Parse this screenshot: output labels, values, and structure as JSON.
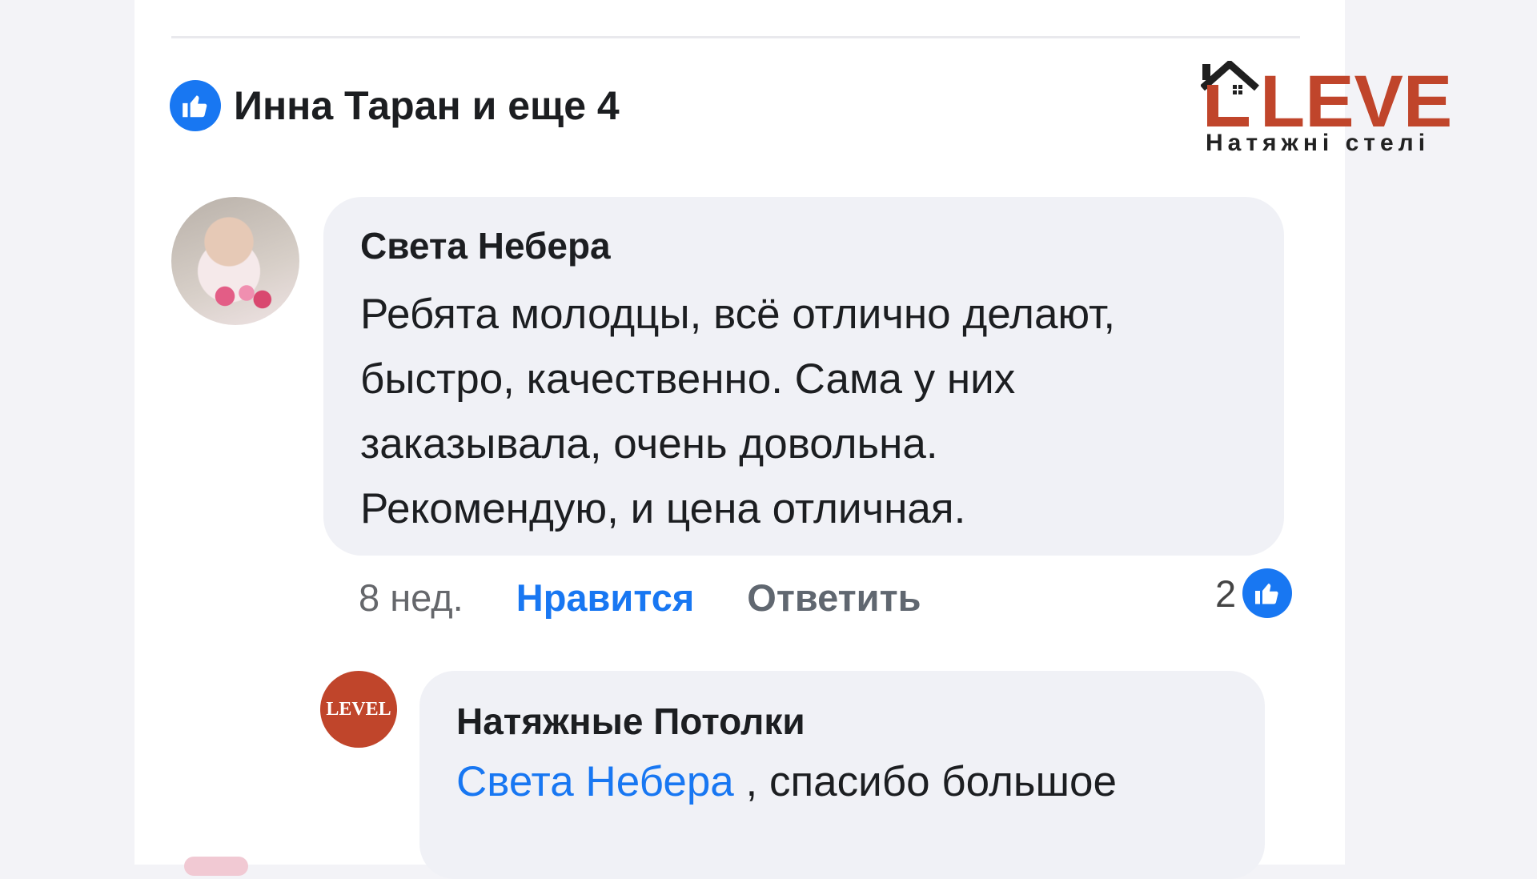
{
  "reactions_summary": {
    "text": "Инна Таран и еще 4",
    "icon": "like-icon"
  },
  "brand": {
    "name": "LEVEL",
    "subtitle": "Натяжні стелі",
    "color": "#c0452b"
  },
  "comment": {
    "author": "Света Небера",
    "lines": [
      "Ребята молодцы, всё отлично делают,",
      "быстро, качественно. Сама у них",
      "заказывала, очень довольна.",
      "Рекомендую, и цена отличная."
    ],
    "time": "8 нед.",
    "like_label": "Нравится",
    "reply_label": "Ответить",
    "reaction_count": "2"
  },
  "reply": {
    "author": "Натяжные Потолки",
    "avatar_text": "LEVEL",
    "mention": "Света Небера",
    "text": " , спасибо большое"
  },
  "colors": {
    "facebook_blue": "#1877f2",
    "bubble": "#f0f1f6"
  }
}
